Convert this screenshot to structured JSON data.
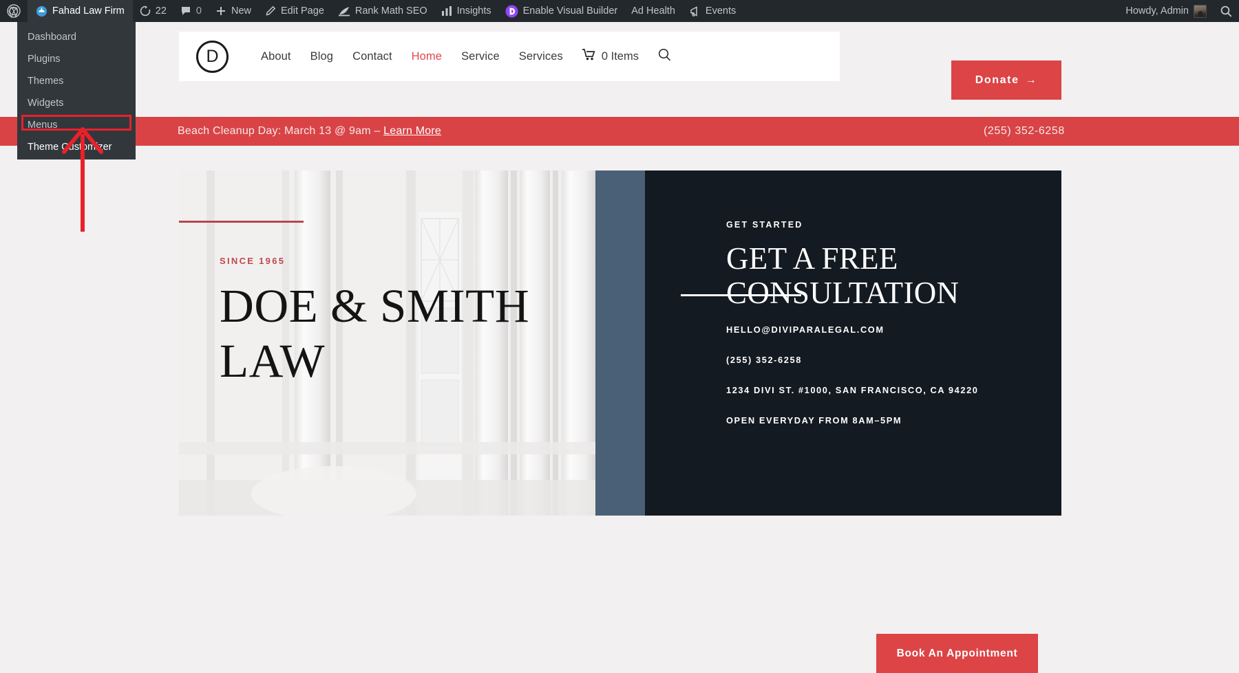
{
  "adminbar": {
    "wp_logo": "wordpress-logo",
    "site_name": "Fahad Law Firm",
    "updates_count": "22",
    "comments_count": "0",
    "new_label": "New",
    "edit_page_label": "Edit Page",
    "rank_math_label": "Rank Math SEO",
    "insights_label": "Insights",
    "visual_builder_label": "Enable Visual Builder",
    "ad_health_label": "Ad Health",
    "events_label": "Events",
    "howdy": "Howdy, Admin",
    "search_icon": "search-icon"
  },
  "dropdown": {
    "items": [
      {
        "label": "Dashboard",
        "highlighted": false
      },
      {
        "label": "Plugins",
        "highlighted": false
      },
      {
        "label": "Themes",
        "highlighted": false
      },
      {
        "label": "Widgets",
        "highlighted": false
      },
      {
        "label": "Menus",
        "highlighted": false
      },
      {
        "label": "Theme Customizer",
        "highlighted": true
      }
    ],
    "highlight_color": "#e8212a",
    "annotation": "red-arrow-pointing-to-theme-customizer"
  },
  "site_header": {
    "logo_letter": "D",
    "nav": [
      {
        "label": "About",
        "active": false
      },
      {
        "label": "Blog",
        "active": false
      },
      {
        "label": "Contact",
        "active": false
      },
      {
        "label": "Home",
        "active": true
      },
      {
        "label": "Service",
        "active": false
      },
      {
        "label": "Services",
        "active": false
      }
    ],
    "cart_label": "0 Items",
    "cart_icon": "shopping-cart-icon",
    "search_icon": "search-icon",
    "donate_label": "Donate",
    "donate_arrow": "→",
    "accent_color": "#dc4446",
    "active_link_color": "#e0474c"
  },
  "promo_bar": {
    "text": "Beach Cleanup Day: March 13 @ 9am – ",
    "link_label": "Learn More",
    "phone": "(255) 352-6258",
    "background": "#d94346"
  },
  "hero": {
    "left": {
      "since": "SINCE 1965",
      "firm_name": "DOE & SMITH LAW",
      "rule_color": "#b5484d"
    },
    "accent_stripe_color": "#4a6076",
    "right": {
      "background": "#141a21",
      "eyebrow": "GET STARTED",
      "headline": "GET A FREE CONSULTATION",
      "contacts": [
        "HELLO@DIVIPARALEGAL.COM",
        "(255) 352-6258",
        "1234 DIVI ST. #1000, SAN FRANCISCO, CA 94220",
        "OPEN EVERYDAY FROM 8AM–5PM"
      ],
      "cta_label": "Book An Appointment"
    }
  }
}
